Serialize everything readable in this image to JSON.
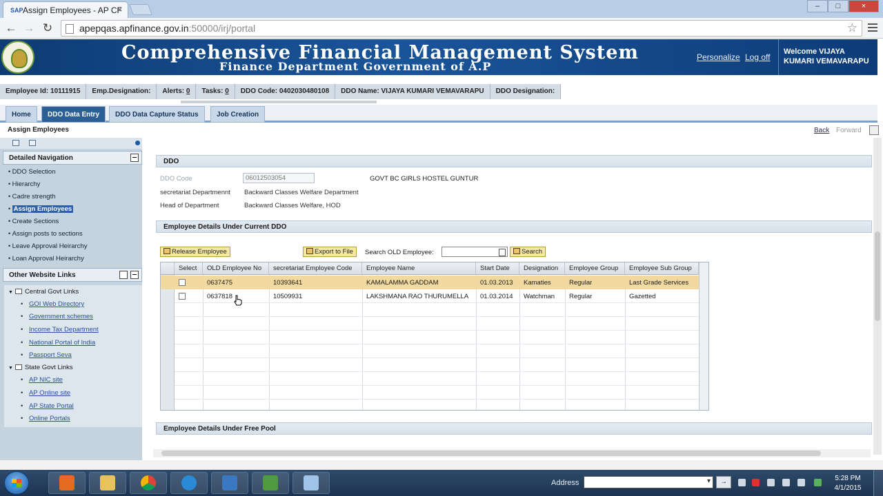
{
  "browser": {
    "tab_title": "Assign Employees - AP CF",
    "url_host": "apepqas.apfinance.gov.in",
    "url_rest": ":50000/irj/portal"
  },
  "header": {
    "title": "Comprehensive Financial Management System",
    "subtitle": "Finance Department Government of A.P",
    "personalize": "Personalize",
    "logoff": "Log off",
    "welcome": "Welcome VIJAYA KUMARI VEMAVARAPU"
  },
  "infobar": {
    "employee_id": "Employee Id: 10111915",
    "designation": "Emp.Designation:",
    "alerts_label": "Alerts:",
    "alerts_count": "0",
    "tasks_label": "Tasks:",
    "tasks_count": "0",
    "ddo_code": "DDO Code: 0402030480108",
    "ddo_name": "DDO Name: VIJAYA KUMARI VEMAVARAPU",
    "ddo_designation": "DDO Designation:"
  },
  "nav_tabs": [
    "Home",
    "DDO Data Entry",
    "DDO Data Capture Status",
    "Job Creation"
  ],
  "page": {
    "title": "Assign Employees",
    "back": "Back",
    "forward": "Forward"
  },
  "left_nav": {
    "detailed_title": "Detailed Navigation",
    "items": [
      "DDO Selection",
      "Hierarchy",
      "Cadre strength",
      "Assign Employees",
      "Create Sections",
      "Assign posts to sections",
      "Leave Approval Heirarchy",
      "Loan Approval Heirarchy"
    ],
    "other_title": "Other Website Links",
    "central_folder": "Central Govt Links",
    "central_links": [
      "GOI Web Directory",
      "Government schemes",
      "Income Tax Department",
      "National Portal of India",
      "Passport Seva"
    ],
    "state_folder": "State Govt Links",
    "state_links": [
      "AP NIC site",
      "AP Online site",
      "AP State Portal",
      "Online Portals"
    ]
  },
  "ddo": {
    "section_title": "DDO",
    "code_label": "DDO Code",
    "code_value": "06012503054",
    "name": "GOVT BC GIRLS HOSTEL GUNTUR",
    "secretariat_label": "secretariat Departmennt",
    "secretariat_value": "Backward Classes Welfare Department",
    "hod_label": "Head of Department",
    "hod_value": "Backward Classes Welfare, HOD"
  },
  "employees": {
    "section_title": "Employee Details Under Current DDO",
    "release_btn": "Release Employee",
    "export_btn": "Export to File",
    "search_label": "Search OLD Employee:",
    "search_value": "",
    "search_btn": "Search",
    "columns": [
      "Select",
      "OLD Employee No",
      "secretariat Employee Code",
      "Employee Name",
      "Start Date",
      "Designation",
      "Employee Group",
      "Employee Sub Group"
    ],
    "rows": [
      [
        "0637475",
        "10393641",
        "KAMALAMMA GADDAM",
        "01.03.2013",
        "Kamaties",
        "Regular",
        "Last Grade Services"
      ],
      [
        "0637818",
        "10509931",
        "LAKSHMANA RAO THURUMELLA",
        "01.03.2014",
        "Watchman",
        "Regular",
        "Gazetted"
      ]
    ]
  },
  "free_pool": {
    "section_title": "Employee Details Under Free Pool"
  },
  "taskbar": {
    "address_label": "Address",
    "time": "5:28 PM",
    "date": "4/1/2015"
  }
}
